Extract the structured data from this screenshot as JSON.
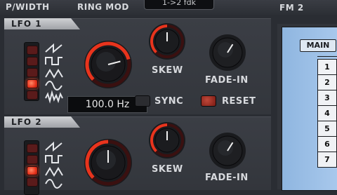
{
  "header": {
    "labels": [
      "P/WIDTH",
      "RING MOD",
      "FM 2"
    ],
    "preset_value": "1->2 fdk"
  },
  "lfo1": {
    "title": "LFO 1",
    "skew_label": "SKEW",
    "fadein_label": "FADE-IN",
    "sync_label": "SYNC",
    "reset_label": "RESET",
    "rate_display": "100.0 Hz",
    "rate_level": 0.78,
    "skew_level": 0.5,
    "fadein_level": 0.62,
    "selected_wave_index": 3
  },
  "lfo2": {
    "title": "LFO 2",
    "skew_label": "SKEW",
    "fadein_label": "FADE-IN",
    "rate_level": 0.5,
    "skew_level": 0.5,
    "fadein_level": 0.62,
    "selected_wave_index": 2
  },
  "matrix": {
    "main_label": "MAIN",
    "rows": [
      "1",
      "2",
      "3",
      "4",
      "5",
      "6",
      "7"
    ]
  },
  "colors": {
    "accent_red": "#e8341d",
    "screen_blue": "#9cc0e8"
  },
  "icons": [
    "sawtooth-wave-icon",
    "square-wave-icon",
    "triangle-wave-icon",
    "sine-wave-icon",
    "random-wave-icon"
  ]
}
